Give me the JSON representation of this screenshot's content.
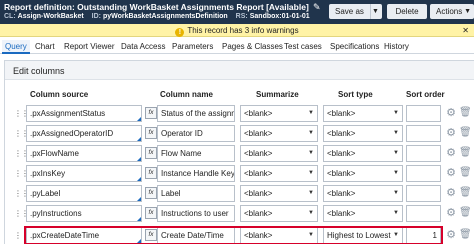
{
  "header": {
    "title": "Report definition: Outstanding WorkBasket Assignments Report [Available]",
    "meta": [
      {
        "key": "CL:",
        "value": "Assign-WorkBasket"
      },
      {
        "key": "ID:",
        "value": "pyWorkBasketAssignmentsDefinition"
      },
      {
        "key": "RS:",
        "value": "Sandbox:01-01-01"
      }
    ],
    "save_as_label": "Save as",
    "delete_label": "Delete",
    "actions_label": "Actions"
  },
  "banner": {
    "text": "This record has 3 info warnings",
    "close": "✕"
  },
  "tabs": [
    "Query",
    "Chart",
    "Report Viewer",
    "Data Access",
    "Parameters",
    "Pages & Classes",
    "Test cases",
    "Specifications",
    "History"
  ],
  "panel": {
    "title": "Edit columns"
  },
  "columns": {
    "source": "Column source",
    "name": "Column name",
    "summarize": "Summarize",
    "sort_type": "Sort type",
    "sort_order": "Sort order"
  },
  "rows": [
    {
      "source": ".pxAssignmentStatus",
      "name": "Status of the assignment",
      "summarize": "<blank>",
      "sort_type": "<blank>",
      "sort_order": ""
    },
    {
      "source": ".pxAssignedOperatorID",
      "name": "Operator ID",
      "summarize": "<blank>",
      "sort_type": "<blank>",
      "sort_order": ""
    },
    {
      "source": ".pxFlowName",
      "name": "Flow Name",
      "summarize": "<blank>",
      "sort_type": "<blank>",
      "sort_order": ""
    },
    {
      "source": ".pxInsKey",
      "name": "Instance Handle Key",
      "summarize": "<blank>",
      "sort_type": "<blank>",
      "sort_order": ""
    },
    {
      "source": ".pyLabel",
      "name": "Label",
      "summarize": "<blank>",
      "sort_type": "<blank>",
      "sort_order": ""
    },
    {
      "source": ".pyInstructions",
      "name": "Instructions to user",
      "summarize": "<blank>",
      "sort_type": "<blank>",
      "sort_order": ""
    },
    {
      "source": ".pxCreateDateTime",
      "name": "Create Date/Time",
      "summarize": "<blank>",
      "sort_type": "Highest to Lowest",
      "sort_order": "1"
    }
  ],
  "icons": {
    "drag": "drag-handle-icon",
    "fx": "fx",
    "gear": "gear-icon",
    "trash": "trash-icon"
  },
  "colors": {
    "header_bg": "#20344c",
    "accent": "#1a6ac0",
    "highlight": "#d6002a",
    "banner_bg": "#fff3a6"
  }
}
